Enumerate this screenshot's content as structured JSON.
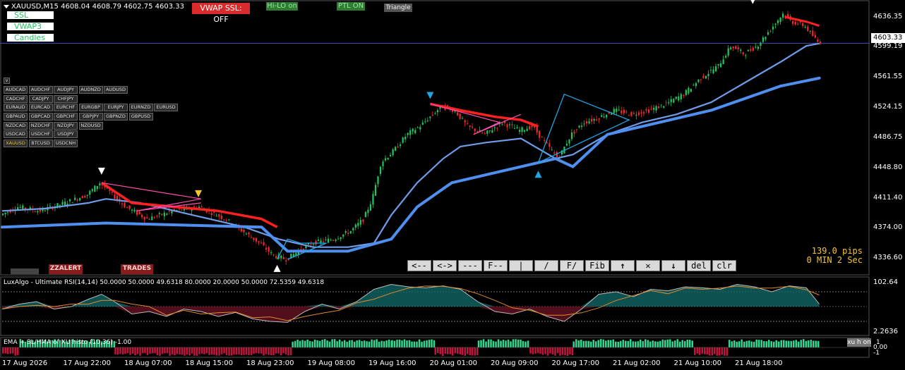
{
  "header": {
    "symbol_line": "XAUUSD,M15  4608.04 4608.79 4602.75 4603.33"
  },
  "left_tags": [
    {
      "label": "SSL"
    },
    {
      "label": "VWAP3"
    },
    {
      "label": "Candles"
    }
  ],
  "top_buttons": {
    "vwap_ssl": "VWAP SSL: OFF",
    "hilo": "Hi-LO on",
    "ptl": "PTL ON",
    "triangle": "Triangle"
  },
  "pair_panel": {
    "toggle_label": "v",
    "rows": [
      [
        "AUDCAD",
        "AUDCHF",
        "AUDJPY",
        "AUDNZD",
        "AUDUSD"
      ],
      [
        "CADCHF",
        "CADJPY",
        "CHFJPY"
      ],
      [
        "EURAUD",
        "EURCAD",
        "EURCHF",
        "EURGBP",
        "EURJPY",
        "EURNZD",
        "EURUSD"
      ],
      [
        "GBPAUD",
        "GBPCAD",
        "GBPCHF",
        "GBPJPY",
        "GBPNZD",
        "GBPUSD"
      ],
      [
        "NZDCAD",
        "NZDCHF",
        "NZDJPY",
        "NZDUSD"
      ],
      [
        "USDCAD",
        "USDCHF",
        "USDJPY"
      ],
      [
        "XAUUSD",
        "BTCUSD",
        "USDCNH"
      ]
    ],
    "active": "XAUUSD"
  },
  "bottom_buttons": {
    "zzalert": "ZZALERT",
    "trades": "TRADES"
  },
  "toolbar": [
    "<--",
    "<->",
    "---",
    "F--",
    "|",
    "/",
    "F/",
    "Fib",
    "up-arrow",
    "close",
    "down-arrow",
    "del",
    "clr"
  ],
  "info": {
    "pips": "139.0 pips",
    "timer": "0 MIN 2 Sec"
  },
  "price_axis": {
    "current": "4603.33",
    "ticks": [
      {
        "label": "4636.35",
        "value": 4636.35
      },
      {
        "label": "4599.19",
        "value": 4599.19
      },
      {
        "label": "4561.55",
        "value": 4561.55
      },
      {
        "label": "4524.15",
        "value": 4524.15
      },
      {
        "label": "4486.75",
        "value": 4486.75
      },
      {
        "label": "4448.80",
        "value": 4448.8
      },
      {
        "label": "4411.40",
        "value": 4411.4
      },
      {
        "label": "4374.00",
        "value": 4374.0
      },
      {
        "label": "4336.60",
        "value": 4336.6
      }
    ]
  },
  "rsi_panel": {
    "title": "LuxAlgo - Ultimate RSI(14,14) 50.0000 50.0000 49.6318 80.0000 20.0000 50.0000 72.5359 49.6318",
    "top_label": "102.64",
    "bottom_label": "2.2636"
  },
  "hist_panel": {
    "title": "EMA + SL/HMA of  XU histo (10,36) -1.00",
    "btn": "xu h on",
    "label_zero": "0.00",
    "label_one": "1",
    "label_minus": "-1"
  },
  "time_axis": [
    "17 Aug 2026",
    "17 Aug 22:00",
    "18 Aug 07:00",
    "18 Aug 15:00",
    "18 Aug 23:00",
    "19 Aug 08:00",
    "19 Aug 16:00",
    "20 Aug 01:00",
    "20 Aug 09:00",
    "20 Aug 17:00",
    "21 Aug 02:00",
    "21 Aug 10:00",
    "21 Aug 18:00"
  ],
  "colors": {
    "bull": "#22c55e",
    "bear": "#ef2b2b",
    "ema_fast": "#6f9be8",
    "ema_slow": "#4f8ff0",
    "ssl_red": "#ff2020",
    "pink_line": "#ff4fb0",
    "tri_blue": "#1fa6e6",
    "current_line": "#3a56b8",
    "gold": "#f4c430"
  },
  "chart_data": {
    "type": "line",
    "xlim": [
      0,
      1
    ],
    "ylim": [
      4320,
      4650
    ],
    "close_path": [
      [
        0.0,
        4390
      ],
      [
        0.02,
        4400
      ],
      [
        0.045,
        4395
      ],
      [
        0.075,
        4405
      ],
      [
        0.1,
        4415
      ],
      [
        0.115,
        4430
      ],
      [
        0.125,
        4420
      ],
      [
        0.145,
        4400
      ],
      [
        0.17,
        4385
      ],
      [
        0.2,
        4395
      ],
      [
        0.23,
        4400
      ],
      [
        0.26,
        4385
      ],
      [
        0.28,
        4370
      ],
      [
        0.3,
        4355
      ],
      [
        0.315,
        4340
      ],
      [
        0.33,
        4335
      ],
      [
        0.345,
        4345
      ],
      [
        0.36,
        4355
      ],
      [
        0.385,
        4360
      ],
      [
        0.405,
        4370
      ],
      [
        0.42,
        4385
      ],
      [
        0.43,
        4410
      ],
      [
        0.44,
        4455
      ],
      [
        0.455,
        4470
      ],
      [
        0.47,
        4490
      ],
      [
        0.485,
        4500
      ],
      [
        0.5,
        4515
      ],
      [
        0.51,
        4525
      ],
      [
        0.525,
        4520
      ],
      [
        0.54,
        4500
      ],
      [
        0.56,
        4490
      ],
      [
        0.58,
        4505
      ],
      [
        0.6,
        4495
      ],
      [
        0.615,
        4500
      ],
      [
        0.63,
        4480
      ],
      [
        0.645,
        4460
      ],
      [
        0.66,
        4490
      ],
      [
        0.675,
        4505
      ],
      [
        0.69,
        4510
      ],
      [
        0.71,
        4520
      ],
      [
        0.73,
        4515
      ],
      [
        0.75,
        4520
      ],
      [
        0.77,
        4528
      ],
      [
        0.79,
        4540
      ],
      [
        0.81,
        4560
      ],
      [
        0.83,
        4575
      ],
      [
        0.845,
        4600
      ],
      [
        0.86,
        4590
      ],
      [
        0.875,
        4600
      ],
      [
        0.89,
        4620
      ],
      [
        0.905,
        4640
      ],
      [
        0.915,
        4630
      ],
      [
        0.93,
        4625
      ],
      [
        0.945,
        4605
      ]
    ],
    "ema_path": [
      [
        0.0,
        4395
      ],
      [
        0.05,
        4398
      ],
      [
        0.1,
        4405
      ],
      [
        0.12,
        4410
      ],
      [
        0.16,
        4405
      ],
      [
        0.2,
        4395
      ],
      [
        0.24,
        4385
      ],
      [
        0.28,
        4375
      ],
      [
        0.32,
        4360
      ],
      [
        0.36,
        4350
      ],
      [
        0.4,
        4350
      ],
      [
        0.43,
        4355
      ],
      [
        0.45,
        4390
      ],
      [
        0.48,
        4430
      ],
      [
        0.51,
        4460
      ],
      [
        0.53,
        4475
      ],
      [
        0.56,
        4480
      ],
      [
        0.6,
        4485
      ],
      [
        0.64,
        4460
      ],
      [
        0.66,
        4465
      ],
      [
        0.7,
        4490
      ],
      [
        0.74,
        4505
      ],
      [
        0.78,
        4515
      ],
      [
        0.82,
        4530
      ],
      [
        0.86,
        4555
      ],
      [
        0.9,
        4580
      ],
      [
        0.93,
        4600
      ],
      [
        0.945,
        4603
      ]
    ],
    "slow_path": [
      [
        0.0,
        4375
      ],
      [
        0.12,
        4380
      ],
      [
        0.3,
        4375
      ],
      [
        0.33,
        4345
      ],
      [
        0.4,
        4345
      ],
      [
        0.45,
        4360
      ],
      [
        0.48,
        4400
      ],
      [
        0.52,
        4430
      ],
      [
        0.64,
        4460
      ],
      [
        0.66,
        4450
      ],
      [
        0.7,
        4490
      ],
      [
        0.76,
        4505
      ],
      [
        0.82,
        4520
      ],
      [
        0.9,
        4550
      ],
      [
        0.945,
        4560
      ]
    ],
    "rsi": [
      [
        0.0,
        45
      ],
      [
        0.02,
        55
      ],
      [
        0.04,
        60
      ],
      [
        0.06,
        45
      ],
      [
        0.08,
        50
      ],
      [
        0.1,
        65
      ],
      [
        0.115,
        75
      ],
      [
        0.13,
        60
      ],
      [
        0.15,
        35
      ],
      [
        0.17,
        40
      ],
      [
        0.19,
        30
      ],
      [
        0.21,
        45
      ],
      [
        0.23,
        40
      ],
      [
        0.25,
        30
      ],
      [
        0.27,
        38
      ],
      [
        0.29,
        25
      ],
      [
        0.31,
        20
      ],
      [
        0.33,
        18
      ],
      [
        0.35,
        40
      ],
      [
        0.37,
        55
      ],
      [
        0.39,
        45
      ],
      [
        0.41,
        60
      ],
      [
        0.43,
        85
      ],
      [
        0.45,
        95
      ],
      [
        0.47,
        90
      ],
      [
        0.49,
        88
      ],
      [
        0.51,
        92
      ],
      [
        0.53,
        85
      ],
      [
        0.55,
        60
      ],
      [
        0.57,
        40
      ],
      [
        0.59,
        35
      ],
      [
        0.61,
        45
      ],
      [
        0.63,
        30
      ],
      [
        0.65,
        20
      ],
      [
        0.67,
        45
      ],
      [
        0.69,
        75
      ],
      [
        0.71,
        80
      ],
      [
        0.73,
        70
      ],
      [
        0.75,
        85
      ],
      [
        0.77,
        82
      ],
      [
        0.79,
        90
      ],
      [
        0.81,
        88
      ],
      [
        0.83,
        85
      ],
      [
        0.85,
        95
      ],
      [
        0.87,
        90
      ],
      [
        0.89,
        80
      ],
      [
        0.91,
        92
      ],
      [
        0.93,
        88
      ],
      [
        0.945,
        55
      ]
    ],
    "hist_segments": [
      {
        "from": 0.0,
        "to": 0.02,
        "sign": -1
      },
      {
        "from": 0.02,
        "to": 0.13,
        "sign": 1
      },
      {
        "from": 0.13,
        "to": 0.335,
        "sign": -1
      },
      {
        "from": 0.335,
        "to": 0.45,
        "sign": 1
      },
      {
        "from": 0.45,
        "to": 0.5,
        "sign": 1
      },
      {
        "from": 0.5,
        "to": 0.55,
        "sign": -1
      },
      {
        "from": 0.55,
        "to": 0.61,
        "sign": 1
      },
      {
        "from": 0.61,
        "to": 0.66,
        "sign": -1
      },
      {
        "from": 0.66,
        "to": 0.74,
        "sign": 1
      },
      {
        "from": 0.74,
        "to": 0.8,
        "sign": 1
      },
      {
        "from": 0.8,
        "to": 0.84,
        "sign": -1
      },
      {
        "from": 0.84,
        "to": 0.945,
        "sign": 1
      }
    ]
  }
}
